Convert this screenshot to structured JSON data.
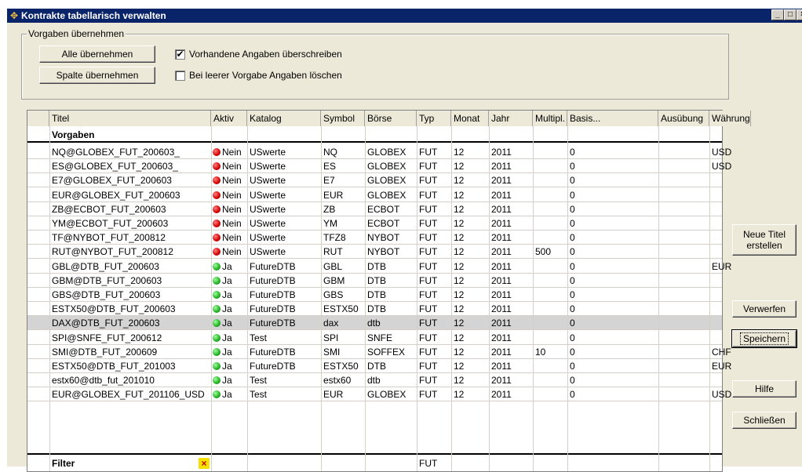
{
  "window": {
    "title": "Kontrakte tabellarisch verwalten",
    "controls": [
      "_",
      "□",
      "×"
    ]
  },
  "vorgaben_group": {
    "label": "Vorgaben übernehmen",
    "btn_all": "Alle übernehmen",
    "btn_column": "Spalte übernehmen",
    "chk_overwrite": {
      "label": "Vorhandene Angaben überschreiben",
      "checked": true
    },
    "chk_clear": {
      "label": "Bei leerer Vorgabe Angaben löschen",
      "checked": false
    }
  },
  "grid": {
    "columns": [
      "Titel",
      "Aktiv",
      "Katalog",
      "Symbol",
      "Börse",
      "Typ",
      "Monat",
      "Jahr",
      "Multipl.",
      "Basis...",
      "Ausübung",
      "Währung"
    ],
    "vorgaben_label": "Vorgaben",
    "rows": [
      {
        "titel": "NQ@GLOBEX_FUT_200603_",
        "aktiv": "Nein",
        "status": "red",
        "katalog": "USwerte",
        "symbol": "NQ",
        "boerse": "GLOBEX",
        "typ": "FUT",
        "monat": "12",
        "jahr": "2011",
        "multipl": "",
        "basis": "0",
        "ausuebung": "",
        "waehrung": "USD"
      },
      {
        "titel": "ES@GLOBEX_FUT_200603_",
        "aktiv": "Nein",
        "status": "red",
        "katalog": "USwerte",
        "symbol": "ES",
        "boerse": "GLOBEX",
        "typ": "FUT",
        "monat": "12",
        "jahr": "2011",
        "multipl": "",
        "basis": "0",
        "ausuebung": "",
        "waehrung": "USD"
      },
      {
        "titel": "E7@GLOBEX_FUT_200603",
        "aktiv": "Nein",
        "status": "red",
        "katalog": "USwerte",
        "symbol": "E7",
        "boerse": "GLOBEX",
        "typ": "FUT",
        "monat": "12",
        "jahr": "2011",
        "multipl": "",
        "basis": "0",
        "ausuebung": "",
        "waehrung": ""
      },
      {
        "titel": "EUR@GLOBEX_FUT_200603",
        "aktiv": "Nein",
        "status": "red",
        "katalog": "USwerte",
        "symbol": "EUR",
        "boerse": "GLOBEX",
        "typ": "FUT",
        "monat": "12",
        "jahr": "2011",
        "multipl": "",
        "basis": "0",
        "ausuebung": "",
        "waehrung": ""
      },
      {
        "titel": "ZB@ECBOT_FUT_200603",
        "aktiv": "Nein",
        "status": "red",
        "katalog": "USwerte",
        "symbol": "ZB",
        "boerse": "ECBOT",
        "typ": "FUT",
        "monat": "12",
        "jahr": "2011",
        "multipl": "",
        "basis": "0",
        "ausuebung": "",
        "waehrung": ""
      },
      {
        "titel": "YM@ECBOT_FUT_200603",
        "aktiv": "Nein",
        "status": "red",
        "katalog": "USwerte",
        "symbol": "YM",
        "boerse": "ECBOT",
        "typ": "FUT",
        "monat": "12",
        "jahr": "2011",
        "multipl": "",
        "basis": "0",
        "ausuebung": "",
        "waehrung": ""
      },
      {
        "titel": "TF@NYBOT_FUT_200812",
        "aktiv": "Nein",
        "status": "red",
        "katalog": "USwerte",
        "symbol": "TFZ8",
        "boerse": "NYBOT",
        "typ": "FUT",
        "monat": "12",
        "jahr": "2011",
        "multipl": "",
        "basis": "0",
        "ausuebung": "",
        "waehrung": ""
      },
      {
        "titel": "RUT@NYBOT_FUT_200812",
        "aktiv": "Nein",
        "status": "red",
        "katalog": "USwerte",
        "symbol": "RUT",
        "boerse": "NYBOT",
        "typ": "FUT",
        "monat": "12",
        "jahr": "2011",
        "multipl": "500",
        "basis": "0",
        "ausuebung": "",
        "waehrung": ""
      },
      {
        "titel": "GBL@DTB_FUT_200603",
        "aktiv": "Ja",
        "status": "green",
        "katalog": "FutureDTB",
        "symbol": "GBL",
        "boerse": "DTB",
        "typ": "FUT",
        "monat": "12",
        "jahr": "2011",
        "multipl": "",
        "basis": "0",
        "ausuebung": "",
        "waehrung": "EUR"
      },
      {
        "titel": "GBM@DTB_FUT_200603",
        "aktiv": "Ja",
        "status": "green",
        "katalog": "FutureDTB",
        "symbol": "GBM",
        "boerse": "DTB",
        "typ": "FUT",
        "monat": "12",
        "jahr": "2011",
        "multipl": "",
        "basis": "0",
        "ausuebung": "",
        "waehrung": ""
      },
      {
        "titel": "GBS@DTB_FUT_200603",
        "aktiv": "Ja",
        "status": "green",
        "katalog": "FutureDTB",
        "symbol": "GBS",
        "boerse": "DTB",
        "typ": "FUT",
        "monat": "12",
        "jahr": "2011",
        "multipl": "",
        "basis": "0",
        "ausuebung": "",
        "waehrung": ""
      },
      {
        "titel": "ESTX50@DTB_FUT_200603",
        "aktiv": "Ja",
        "status": "green",
        "katalog": "FutureDTB",
        "symbol": "ESTX50",
        "boerse": "DTB",
        "typ": "FUT",
        "monat": "12",
        "jahr": "2011",
        "multipl": "",
        "basis": "0",
        "ausuebung": "",
        "waehrung": ""
      },
      {
        "titel": "DAX@DTB_FUT_200603",
        "aktiv": "Ja",
        "status": "green",
        "katalog": "FutureDTB",
        "symbol": "dax",
        "boerse": "dtb",
        "typ": "FUT",
        "monat": "12",
        "jahr": "2011",
        "multipl": "",
        "basis": "0",
        "ausuebung": "",
        "waehrung": "",
        "selected": true
      },
      {
        "titel": "SPI@SNFE_FUT_200612",
        "aktiv": "Ja",
        "status": "green",
        "katalog": "Test",
        "symbol": "SPI",
        "boerse": "SNFE",
        "typ": "FUT",
        "monat": "12",
        "jahr": "2011",
        "multipl": "",
        "basis": "0",
        "ausuebung": "",
        "waehrung": ""
      },
      {
        "titel": "SMI@DTB_FUT_200609",
        "aktiv": "Ja",
        "status": "green",
        "katalog": "FutureDTB",
        "symbol": "SMI",
        "boerse": "SOFFEX",
        "typ": "FUT",
        "monat": "12",
        "jahr": "2011",
        "multipl": "10",
        "basis": "0",
        "ausuebung": "",
        "waehrung": "CHF"
      },
      {
        "titel": "ESTX50@DTB_FUT_201003",
        "aktiv": "Ja",
        "status": "green",
        "katalog": "FutureDTB",
        "symbol": "ESTX50",
        "boerse": "DTB",
        "typ": "FUT",
        "monat": "12",
        "jahr": "2011",
        "multipl": "",
        "basis": "0",
        "ausuebung": "",
        "waehrung": "EUR"
      },
      {
        "titel": "estx60@dtb_fut_201010",
        "aktiv": "Ja",
        "status": "green",
        "katalog": "Test",
        "symbol": "estx60",
        "boerse": "dtb",
        "typ": "FUT",
        "monat": "12",
        "jahr": "2011",
        "multipl": "",
        "basis": "0",
        "ausuebung": "",
        "waehrung": ""
      },
      {
        "titel": "EUR@GLOBEX_FUT_201106_USD",
        "aktiv": "Ja",
        "status": "green",
        "katalog": "Test",
        "symbol": "EUR",
        "boerse": "GLOBEX",
        "typ": "FUT",
        "monat": "12",
        "jahr": "2011",
        "multipl": "",
        "basis": "0",
        "ausuebung": "",
        "waehrung": "USD"
      }
    ],
    "filter_label": "Filter",
    "filter_typ": "FUT"
  },
  "side_buttons": {
    "neue_titel_line1": "Neue Titel",
    "neue_titel_line2": "erstellen",
    "verwerfen": "Verwerfen",
    "speichern": "Speichern",
    "hilfe": "Hilfe",
    "schliessen": "Schließen"
  },
  "colors": {
    "titlebar": "#0a246a",
    "face": "#ece9d8",
    "selected_row": "#d4d4d4",
    "status_red": "#d00000",
    "status_green": "#20b020"
  }
}
